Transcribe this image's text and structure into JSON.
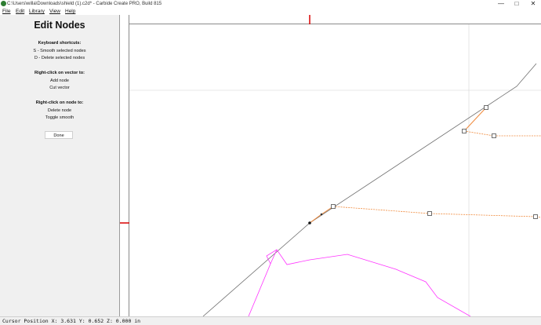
{
  "window": {
    "title": "C:\\Users\\willa\\Downloads\\shield (1).c2d* - Carbide Create PRO, Build 815",
    "minimize_symbol": "—",
    "maximize_symbol": "□",
    "close_symbol": "✕"
  },
  "menu": {
    "items": [
      "File",
      "Edit",
      "Library",
      "View",
      "Help"
    ]
  },
  "sidebar": {
    "heading": "Edit Nodes",
    "shortcuts_title": "Keyboard shortcuts:",
    "shortcuts": [
      "S - Smooth selected nodes",
      "D - Delete selected nodes"
    ],
    "vector_title": "Right-click on vector to:",
    "vector_actions": [
      "Add node",
      "Cut vector"
    ],
    "node_title": "Right-click on node to:",
    "node_actions": [
      "Delete node",
      "Toggle smooth"
    ],
    "done_label": "Done"
  },
  "status": {
    "text": "Cursor Position X: 3.631 Y: 0.652 Z: 0.000 in"
  },
  "colors": {
    "selected_vector": "#f08a3c",
    "other_vector": "#ff33ff",
    "guide_line": "#6e6e6e",
    "ruler_marker": "#d90000"
  },
  "icons": {
    "app": "carbide-create-app-icon",
    "minimize": "minimize-icon",
    "maximize": "maximize-icon",
    "close": "close-icon"
  }
}
